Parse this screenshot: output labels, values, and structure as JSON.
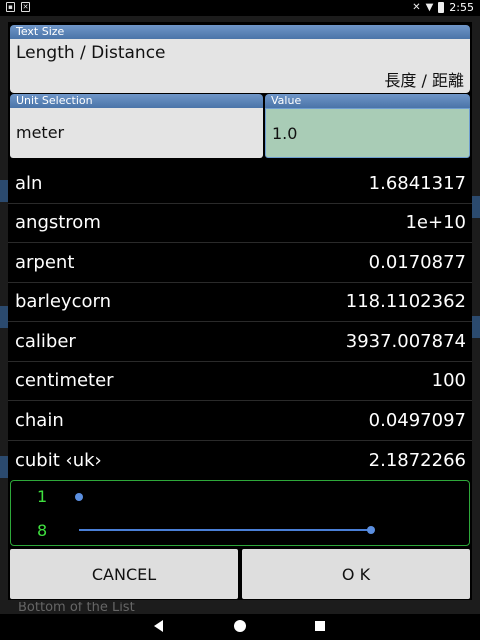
{
  "status_bar": {
    "time": "2:55"
  },
  "category_panel": {
    "label": "Text Size",
    "name_en": "Length / Distance",
    "name_zh": "長度 / 距離"
  },
  "unit_panel": {
    "label": "Unit  Selection",
    "value": "meter"
  },
  "value_panel": {
    "label": "Value",
    "value": "1.0"
  },
  "results": [
    {
      "unit": "aln",
      "value": "1.6841317"
    },
    {
      "unit": "angstrom",
      "value": "1e+10"
    },
    {
      "unit": "arpent",
      "value": "0.0170877"
    },
    {
      "unit": "barleycorn",
      "value": "118.1102362"
    },
    {
      "unit": "caliber",
      "value": "3937.007874"
    },
    {
      "unit": "centimeter",
      "value": "100"
    },
    {
      "unit": "chain",
      "value": "0.0497097"
    },
    {
      "unit": "cubit ‹uk›",
      "value": "2.1872266"
    }
  ],
  "precision_slider": {
    "min_label": "1",
    "max_label": "8",
    "value": 8,
    "min": 1,
    "max": 8,
    "accent_color": "#3fe03f",
    "track_color": "#4a7fd6"
  },
  "buttons": {
    "cancel": "CANCEL",
    "ok": "O K"
  },
  "background": {
    "footer_text": "Bottom of the List"
  },
  "colors": {
    "header_blue": "#5a84b8",
    "value_field_green": "#a9ccb6",
    "field_gray": "#e4e4e4"
  }
}
